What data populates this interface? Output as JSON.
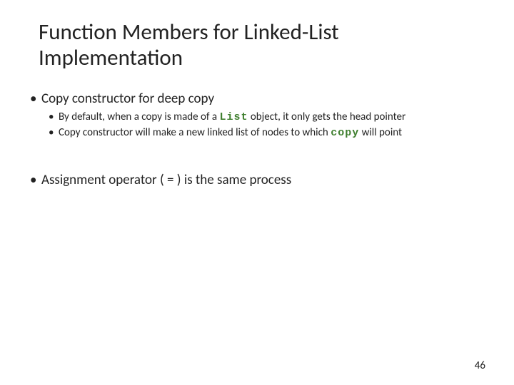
{
  "title": "Function Members for Linked-List Implementation",
  "bullets": {
    "b1": {
      "text": "Copy constructor for deep copy",
      "sub": {
        "s1_pre": "By default, when a copy is made of a ",
        "s1_code": "List",
        "s1_post": " object, it only gets the head pointer",
        "s2_pre": "Copy constructor will make a new linked list of nodes to which ",
        "s2_code": "copy",
        "s2_post": " will point"
      }
    },
    "b2": {
      "text": "Assignment operator ( = ) is the same process"
    }
  },
  "page_number": "46"
}
